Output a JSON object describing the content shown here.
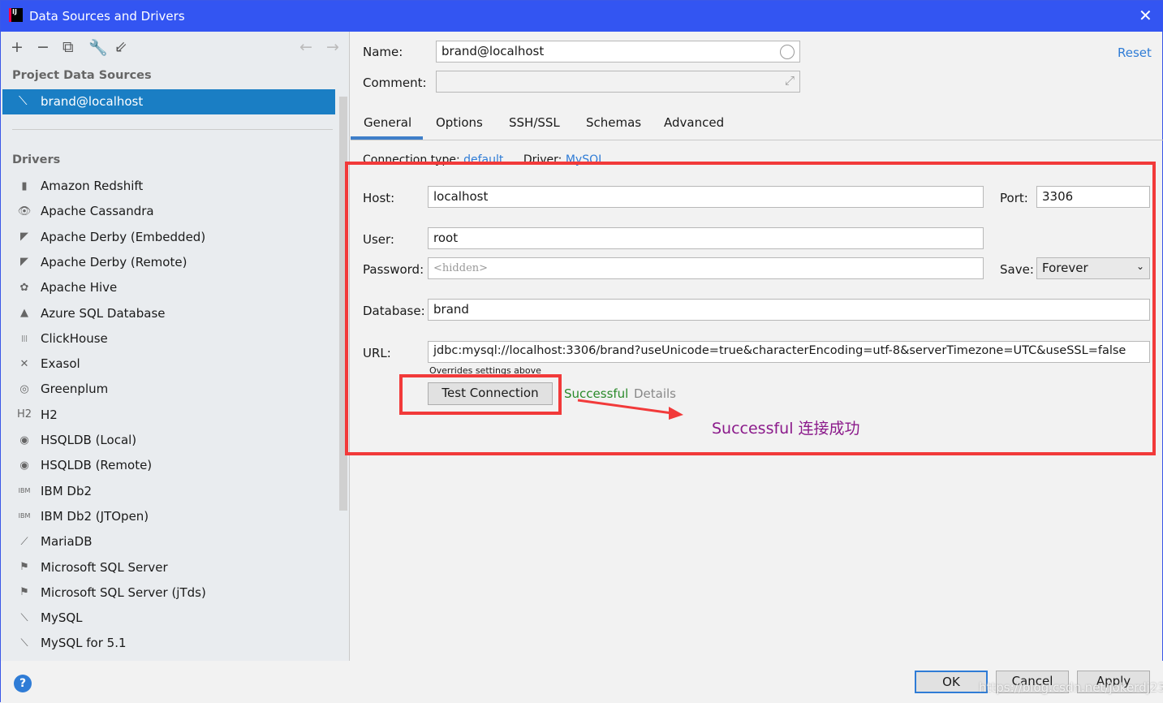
{
  "window": {
    "title": "Data Sources and Drivers",
    "logo_text": "IJ"
  },
  "left": {
    "section_project": "Project Data Sources",
    "selected": "brand@localhost",
    "section_drivers": "Drivers",
    "drivers": [
      {
        "label": "Amazon Redshift",
        "icon": "▮"
      },
      {
        "label": "Apache Cassandra",
        "icon": "👁"
      },
      {
        "label": "Apache Derby (Embedded)",
        "icon": "◤"
      },
      {
        "label": "Apache Derby (Remote)",
        "icon": "◤"
      },
      {
        "label": "Apache Hive",
        "icon": "✿"
      },
      {
        "label": "Azure SQL Database",
        "icon": "▲"
      },
      {
        "label": "ClickHouse",
        "icon": "|||"
      },
      {
        "label": "Exasol",
        "icon": "✕"
      },
      {
        "label": "Greenplum",
        "icon": "◎"
      },
      {
        "label": "H2",
        "icon": "H2"
      },
      {
        "label": "HSQLDB (Local)",
        "icon": "◉"
      },
      {
        "label": "HSQLDB (Remote)",
        "icon": "◉"
      },
      {
        "label": "IBM Db2",
        "icon": "IBM"
      },
      {
        "label": "IBM Db2 (JTOpen)",
        "icon": "IBM"
      },
      {
        "label": "MariaDB",
        "icon": "⟋"
      },
      {
        "label": "Microsoft SQL Server",
        "icon": "⚑"
      },
      {
        "label": "Microsoft SQL Server (jTds)",
        "icon": "⚑"
      },
      {
        "label": "MySQL",
        "icon": "⟍"
      },
      {
        "label": "MySQL for 5.1",
        "icon": "⟍"
      }
    ]
  },
  "form": {
    "name_label": "Name:",
    "name_value": "brand@localhost",
    "comment_label": "Comment:",
    "comment_value": "",
    "reset": "Reset",
    "tabs": [
      "General",
      "Options",
      "SSH/SSL",
      "Schemas",
      "Advanced"
    ],
    "connection_type_label": "Connection type:",
    "connection_type": "default",
    "driver_label": "Driver:",
    "driver": "MySQL",
    "host_label": "Host:",
    "host": "localhost",
    "port_label": "Port:",
    "port": "3306",
    "user_label": "User:",
    "user": "root",
    "password_label": "Password:",
    "password_placeholder": "<hidden>",
    "save_label": "Save:",
    "save_value": "Forever",
    "database_label": "Database:",
    "database": "brand",
    "url_label": "URL:",
    "url": "jdbc:mysql://localhost:3306/brand?useUnicode=true&characterEncoding=utf-8&serverTimezone=UTC&useSSL=false",
    "url_hint": "Overrides settings above",
    "test_button": "Test Connection",
    "status": "Successful",
    "details": "Details",
    "annotation": "Successful 连接成功"
  },
  "colors": {
    "accent": "#1a7ec4",
    "title": "#3355f2",
    "annotation": "#8b1a8b",
    "success": "#2a8a2a",
    "highlight": "#f23a3a"
  },
  "footer": {
    "ok": "OK",
    "cancel": "Cancel",
    "apply": "Apply",
    "watermark": "https://blog.csdn.net/jokerdj233"
  }
}
